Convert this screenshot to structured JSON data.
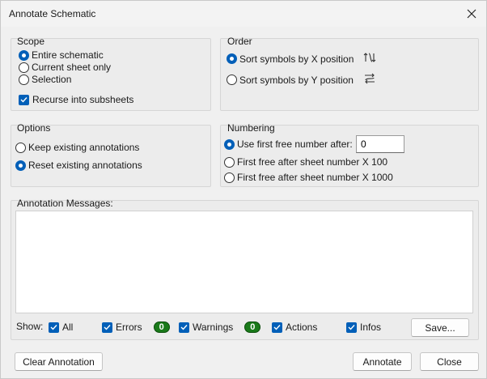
{
  "window": {
    "title": "Annotate Schematic"
  },
  "scope": {
    "title": "Scope",
    "options": [
      "Entire schematic",
      "Current sheet only",
      "Selection"
    ],
    "selected": 0,
    "recurse_label": "Recurse into subsheets",
    "recurse_checked": true
  },
  "order": {
    "title": "Order",
    "options": [
      "Sort symbols by X position",
      "Sort symbols by Y position"
    ],
    "selected": 0
  },
  "options_panel": {
    "title": "Options",
    "options": [
      "Keep existing annotations",
      "Reset existing annotations"
    ],
    "selected": 1
  },
  "numbering": {
    "title": "Numbering",
    "options": [
      "Use first free number after:",
      "First free after sheet number X 100",
      "First free after sheet number X 1000"
    ],
    "selected": 0,
    "first_free_value": "0"
  },
  "messages": {
    "title": "Annotation Messages:",
    "show_label": "Show:",
    "filters": {
      "all": "All",
      "errors": "Errors",
      "errors_count": "0",
      "warnings": "Warnings",
      "warnings_count": "0",
      "actions": "Actions",
      "infos": "Infos"
    },
    "save_label": "Save..."
  },
  "buttons": {
    "clear": "Clear Annotation",
    "annotate": "Annotate",
    "close": "Close"
  },
  "colors": {
    "accent": "#005fb8",
    "badge": "#1a7a1a"
  },
  "icons": [
    "close-icon",
    "sort-x-icon",
    "sort-y-icon",
    "checkmark-icon"
  ]
}
